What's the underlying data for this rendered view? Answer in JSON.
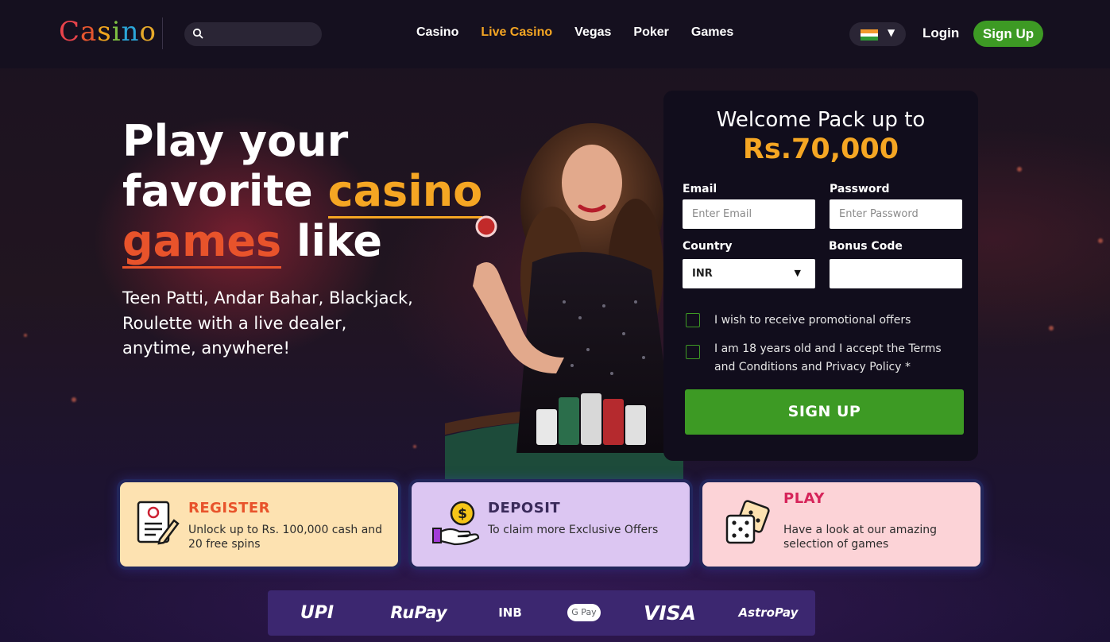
{
  "header": {
    "logo": [
      "C",
      "a",
      "s",
      "i",
      "n",
      "o"
    ],
    "search": {
      "placeholder": ""
    },
    "nav": [
      {
        "label": "Casino",
        "active": false
      },
      {
        "label": "Live Casino",
        "active": true
      },
      {
        "label": "Vegas",
        "active": false
      },
      {
        "label": "Poker",
        "active": false
      },
      {
        "label": "Games",
        "active": false
      }
    ],
    "language_flag": "india-flag-icon",
    "login_label": "Login",
    "signup_label": "Sign Up"
  },
  "hero": {
    "title_line1": "Play your",
    "title_line2_a": "favorite ",
    "title_line2_b": "casino",
    "title_line3_a": "games",
    "title_line3_b": " like",
    "subtitle_line1": "Teen Patti, Andar Bahar, Blackjack,",
    "subtitle_line2": "Roulette with a live dealer,",
    "subtitle_line3": "anytime, anywhere!"
  },
  "signup_form": {
    "title": "Welcome Pack up to",
    "amount": "Rs.70,000",
    "email_label": "Email",
    "email_placeholder": "Enter Email",
    "password_label": "Password",
    "password_placeholder": "Enter Password",
    "country_label": "Country",
    "country_value": "INR",
    "bonus_label": "Bonus Code",
    "bonus_value": "",
    "promo_checkbox_label": "I wish to receive promotional offers",
    "terms_checkbox_line1": "I am 18 years old and I accept the Terms",
    "terms_checkbox_line2": "and Conditions and Privacy Policy *",
    "submit_label": "SIGN UP"
  },
  "steps": [
    {
      "title": "REGISTER",
      "text_line1": "Unlock up to Rs. 100,000 cash and",
      "text_line2": "20 free spins",
      "icon": "register-form-icon",
      "bg": "#fde2b1",
      "title_color": "#e8532b"
    },
    {
      "title": "DEPOSIT",
      "text_line1": "To claim more Exclusive Offers",
      "text_line2": "",
      "icon": "deposit-coin-hand-icon",
      "bg": "#dcc6f2",
      "title_color": "#3a2a5a"
    },
    {
      "title": "PLAY",
      "text_line1": "Have a look at our amazing",
      "text_line2": "selection of games",
      "icon": "dice-icon",
      "bg": "#fcd3d7",
      "title_color": "#d6245a"
    }
  ],
  "payments": {
    "upi": "UPI",
    "rupay": "RuPay",
    "inb": "INB",
    "gpay": "G Pay",
    "visa": "VISA",
    "astropay": "AstroPay"
  },
  "colors": {
    "accent_orange": "#f5a623",
    "accent_red": "#e8532b",
    "cta_green": "#3d9a24",
    "card_bg": "#110d1c",
    "payments_bg": "#3c2770"
  }
}
